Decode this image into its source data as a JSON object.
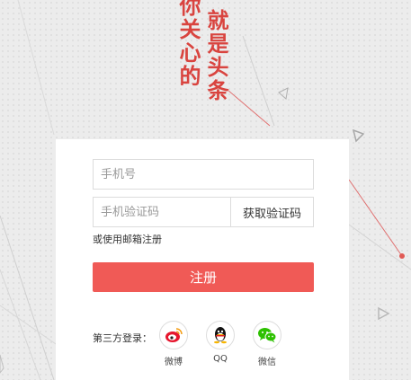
{
  "slogan": {
    "line1": "你关心的",
    "line2": "就是头条"
  },
  "form": {
    "phone_placeholder": "手机号",
    "code_placeholder": "手机验证码",
    "get_code_label": "获取验证码",
    "alt_prefix": "或使用",
    "alt_link": "邮箱注册",
    "register_label": "注册"
  },
  "third_party": {
    "label": "第三方登录：",
    "providers": [
      {
        "name": "微博",
        "icon": "weibo-icon",
        "color": "#e6162d"
      },
      {
        "name": "QQ",
        "icon": "qq-icon",
        "color": "#000000"
      },
      {
        "name": "微信",
        "icon": "wechat-icon",
        "color": "#2dc100"
      }
    ]
  },
  "colors": {
    "accent": "#f05a56",
    "slogan": "#d9443f"
  }
}
